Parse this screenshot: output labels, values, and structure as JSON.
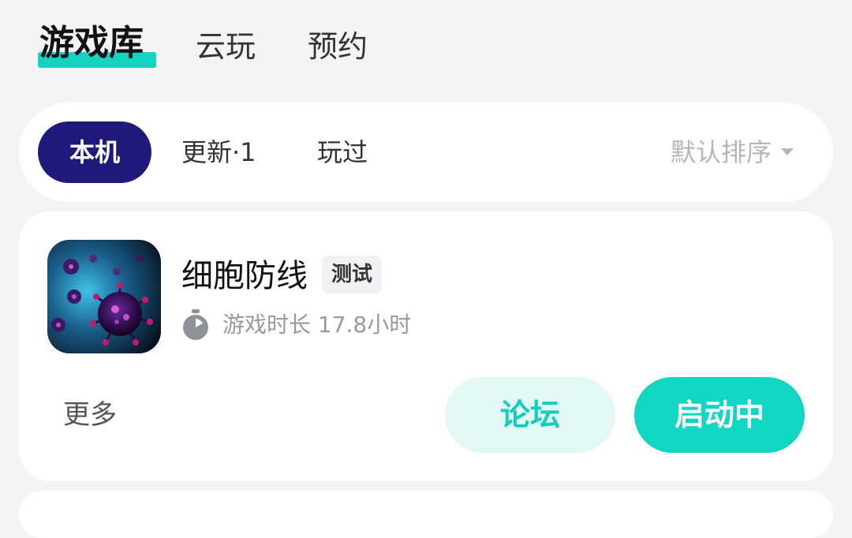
{
  "top_tabs": [
    {
      "label": "游戏库",
      "active": true
    },
    {
      "label": "云玩",
      "active": false
    },
    {
      "label": "预约",
      "active": false
    }
  ],
  "filter": {
    "chips": [
      {
        "label": "本机",
        "active": true
      },
      {
        "label": "更新·1",
        "active": false
      },
      {
        "label": "玩过",
        "active": false
      }
    ],
    "sort_label": "默认排序"
  },
  "game": {
    "icon": "game-icon-virus",
    "title": "细胞防线",
    "tag": "测试",
    "playtime": "游戏时长 17.8小时",
    "more_label": "更多",
    "forum_label": "论坛",
    "launch_label": "启动中"
  },
  "colors": {
    "accent": "#12d6c4",
    "active_chip": "#1f1a7a",
    "background": "#f3f4f6"
  }
}
